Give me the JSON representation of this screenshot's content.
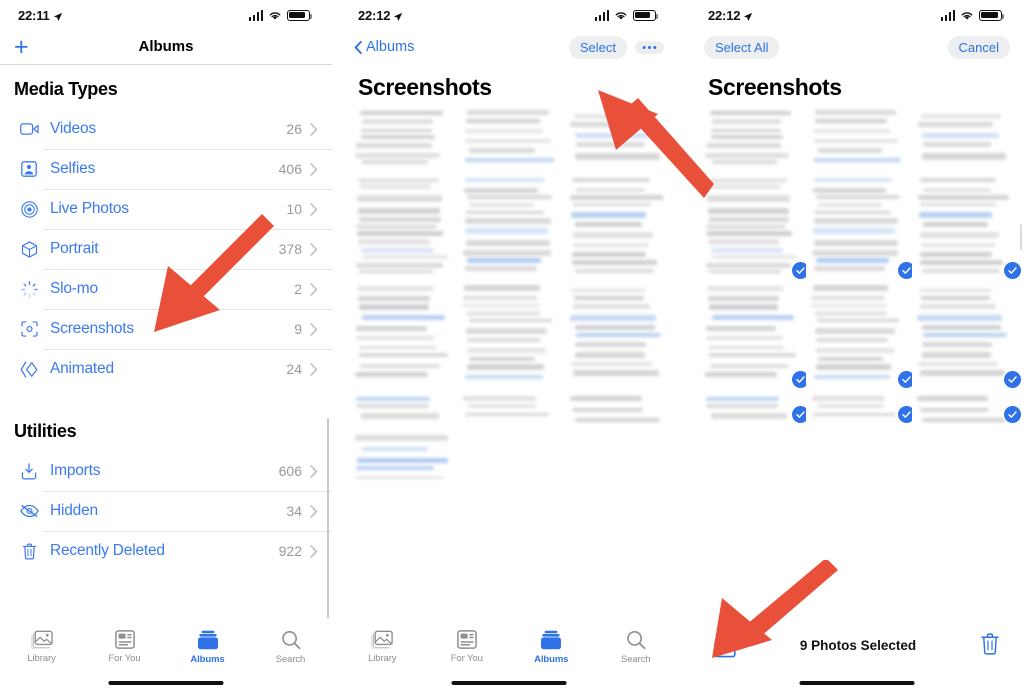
{
  "accent_blue": "#3b7af0",
  "arrow_color": "#e8503a",
  "panel1": {
    "status": {
      "time": "22:11",
      "location_icon": "location-arrow-icon",
      "signal_icon": "cellular-bars-icon",
      "wifi_icon": "wifi-icon",
      "battery_icon": "battery-icon"
    },
    "nav": {
      "add_label": "+",
      "title": "Albums"
    },
    "sections": [
      {
        "heading": "Media Types",
        "items": [
          {
            "icon": "video-camera-icon",
            "label": "Videos",
            "count": "26"
          },
          {
            "icon": "selfie-person-icon",
            "label": "Selfies",
            "count": "406"
          },
          {
            "icon": "live-photo-icon",
            "label": "Live Photos",
            "count": "10"
          },
          {
            "icon": "portrait-cube-icon",
            "label": "Portrait",
            "count": "378"
          },
          {
            "icon": "slo-mo-icon",
            "label": "Slo-mo",
            "count": "2"
          },
          {
            "icon": "screenshot-icon",
            "label": "Screenshots",
            "count": "9"
          },
          {
            "icon": "animated-icon",
            "label": "Animated",
            "count": "24"
          }
        ]
      },
      {
        "heading": "Utilities",
        "items": [
          {
            "icon": "import-download-icon",
            "label": "Imports",
            "count": "606"
          },
          {
            "icon": "eye-slash-icon",
            "label": "Hidden",
            "count": "34"
          },
          {
            "icon": "trash-icon",
            "label": "Recently Deleted",
            "count": "922"
          }
        ]
      }
    ],
    "tabbar": [
      {
        "icon": "library-photos-icon",
        "label": "Library",
        "active": false
      },
      {
        "icon": "for-you-card-icon",
        "label": "For You",
        "active": false
      },
      {
        "icon": "albums-box-icon",
        "label": "Albums",
        "active": true
      },
      {
        "icon": "search-magnifier-icon",
        "label": "Search",
        "active": false
      }
    ]
  },
  "panel2": {
    "status": {
      "time": "22:12",
      "location_icon": "location-arrow-icon",
      "signal_icon": "cellular-bars-icon",
      "wifi_icon": "wifi-icon",
      "battery_icon": "battery-icon"
    },
    "nav": {
      "back_label": "Albums",
      "select_label": "Select",
      "more_label": "···"
    },
    "title": "Screenshots",
    "grid_item_count": 10,
    "tabbar": [
      {
        "icon": "library-photos-icon",
        "label": "Library",
        "active": false
      },
      {
        "icon": "for-you-card-icon",
        "label": "For You",
        "active": false
      },
      {
        "icon": "albums-box-icon",
        "label": "Albums",
        "active": true
      },
      {
        "icon": "search-magnifier-icon",
        "label": "Search",
        "active": false
      }
    ]
  },
  "panel3": {
    "status": {
      "time": "22:12",
      "location_icon": "location-arrow-icon",
      "signal_icon": "cellular-bars-icon",
      "wifi_icon": "wifi-icon",
      "battery_icon": "battery-icon"
    },
    "nav": {
      "select_all_label": "Select All",
      "cancel_label": "Cancel"
    },
    "title": "Screenshots",
    "grid_item_count": 9,
    "selected_indices": [
      3,
      4,
      5,
      6,
      7,
      8,
      9,
      10,
      11
    ],
    "bottombar": {
      "share_icon": "share-up-arrow-icon",
      "count_label": "9 Photos Selected",
      "delete_icon": "trash-icon"
    }
  },
  "annotations": [
    {
      "name": "arrow-to-screenshots-row"
    },
    {
      "name": "arrow-to-select-button"
    },
    {
      "name": "arrow-to-share-button"
    }
  ]
}
